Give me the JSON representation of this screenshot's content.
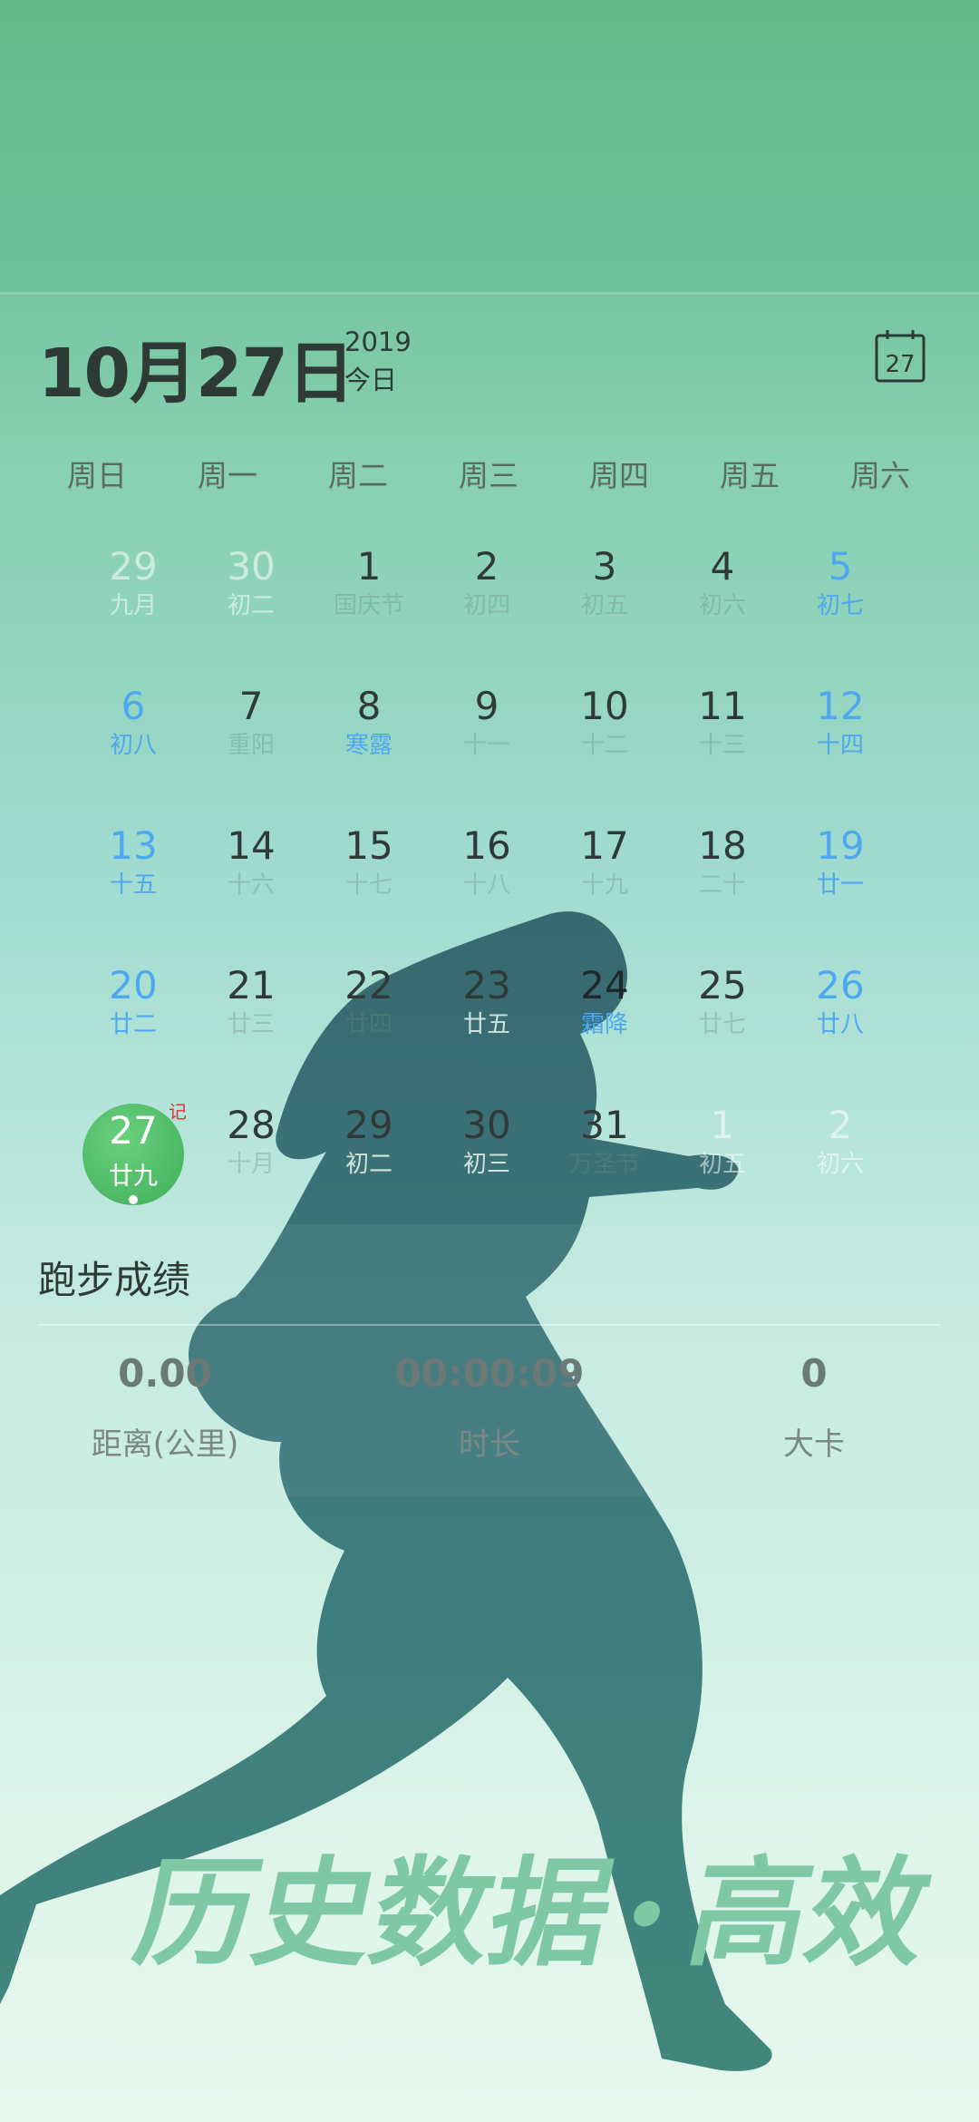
{
  "header": {
    "date": "10月27日",
    "year": "2019",
    "today_label": "今日",
    "calendar_icon_day": "27"
  },
  "weekdays": [
    "周日",
    "周一",
    "周二",
    "周三",
    "周四",
    "周五",
    "周六"
  ],
  "calendar": {
    "rows": [
      [
        {
          "d": "29",
          "l": "九月",
          "t": "faded"
        },
        {
          "d": "30",
          "l": "初二",
          "t": "faded"
        },
        {
          "d": "1",
          "l": "国庆节",
          "t": "dim"
        },
        {
          "d": "2",
          "l": "初四",
          "t": "dim"
        },
        {
          "d": "3",
          "l": "初五",
          "t": "dim"
        },
        {
          "d": "4",
          "l": "初六",
          "t": "dim"
        },
        {
          "d": "5",
          "l": "初七",
          "t": "weekend"
        }
      ],
      [
        {
          "d": "6",
          "l": "初八",
          "t": "weekend"
        },
        {
          "d": "7",
          "l": "重阳",
          "t": "dim"
        },
        {
          "d": "8",
          "l": "寒露",
          "t": "weekend"
        },
        {
          "d": "9",
          "l": "十一",
          "t": "dim"
        },
        {
          "d": "10",
          "l": "十二",
          "t": "dim"
        },
        {
          "d": "11",
          "l": "十三",
          "t": "dim"
        },
        {
          "d": "12",
          "l": "十四",
          "t": "weekend"
        }
      ],
      [
        {
          "d": "13",
          "l": "十五",
          "t": "weekend"
        },
        {
          "d": "14",
          "l": "十六",
          "t": "dim"
        },
        {
          "d": "15",
          "l": "十七",
          "t": "dim"
        },
        {
          "d": "16",
          "l": "十八",
          "t": "dim"
        },
        {
          "d": "17",
          "l": "十九",
          "t": "dim"
        },
        {
          "d": "18",
          "l": "二十",
          "t": "dim"
        },
        {
          "d": "19",
          "l": "廿一",
          "t": "weekend"
        }
      ],
      [
        {
          "d": "20",
          "l": "廿二",
          "t": "weekend"
        },
        {
          "d": "21",
          "l": "廿三",
          "t": "dim"
        },
        {
          "d": "22",
          "l": "廿四",
          "t": "dim"
        },
        {
          "d": "23",
          "l": "廿五",
          "t": "normal"
        },
        {
          "d": "24",
          "l": "霜降",
          "t": "weekend"
        },
        {
          "d": "25",
          "l": "廿七",
          "t": "dim"
        },
        {
          "d": "26",
          "l": "廿八",
          "t": "weekend"
        }
      ],
      [
        {
          "d": "27",
          "l": "廿九",
          "t": "selected"
        },
        {
          "d": "28",
          "l": "十月",
          "t": "dim"
        },
        {
          "d": "29",
          "l": "初二",
          "t": "normal"
        },
        {
          "d": "30",
          "l": "初三",
          "t": "normal"
        },
        {
          "d": "31",
          "l": "万圣节",
          "t": "dim"
        },
        {
          "d": "1",
          "l": "初五",
          "t": "faded"
        },
        {
          "d": "2",
          "l": "初六",
          "t": "faded"
        }
      ]
    ],
    "selected_badge": "记"
  },
  "run": {
    "title": "跑步成绩",
    "distance_value": "0.00",
    "distance_label": "距离(公里)",
    "duration_value": "00:00:09",
    "duration_label": "时长",
    "calories_value": "0",
    "calories_label": "大卡"
  },
  "slogan": {
    "left": "历史数据",
    "separator": "•",
    "right": "高效"
  },
  "colors": {
    "accent_green": "#3fae5a",
    "weekend_blue": "#4ea8ef",
    "slogan_green": "#7fc8a4",
    "runner_teal": "#2f6f74"
  }
}
